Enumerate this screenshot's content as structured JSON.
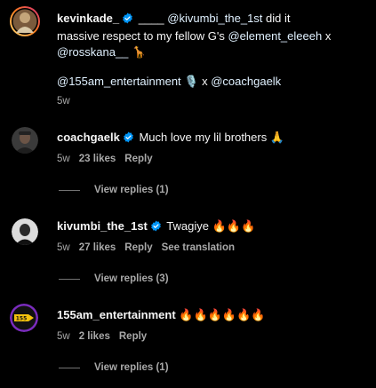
{
  "caption": {
    "username": "kevinkade_",
    "line1_text": "____ ",
    "mention1": "@kivumbi_the_1st",
    "line1_rest": " did it",
    "line2_text": "massive respect to my fellow G's ",
    "mention2": "@element_eleeeh",
    "line2_rest": " x",
    "mention3": "@rosskana__",
    "line3_emoji": "🦒",
    "mention4": "@155am_entertainment",
    "line4_emoji": "🎙️",
    "line4_x": " x ",
    "mention5": "@coachgaelk",
    "time": "5w"
  },
  "comments": [
    {
      "username": "coachgaelk",
      "text": "Much love my lil brothers 🙏",
      "time": "5w",
      "likes": "23 likes",
      "reply": "Reply",
      "view_replies": "View replies (1)"
    },
    {
      "username": "kivumbi_the_1st",
      "text": "Twagiye 🔥🔥🔥",
      "time": "5w",
      "likes": "27 likes",
      "reply": "Reply",
      "translation": "See translation",
      "view_replies": "View replies (3)"
    },
    {
      "username": "155am_entertainment",
      "text": "🔥🔥🔥🔥🔥🔥",
      "time": "5w",
      "likes": "2 likes",
      "reply": "Reply",
      "view_replies": "View replies (1)"
    }
  ],
  "colors": {
    "background": "#000000",
    "verified": "#0095f6",
    "secondary_text": "#a8a8a8",
    "story_ring_start": "#feda75",
    "story_ring_end": "#d62976"
  },
  "icons": [
    "verified-badge-icon"
  ]
}
